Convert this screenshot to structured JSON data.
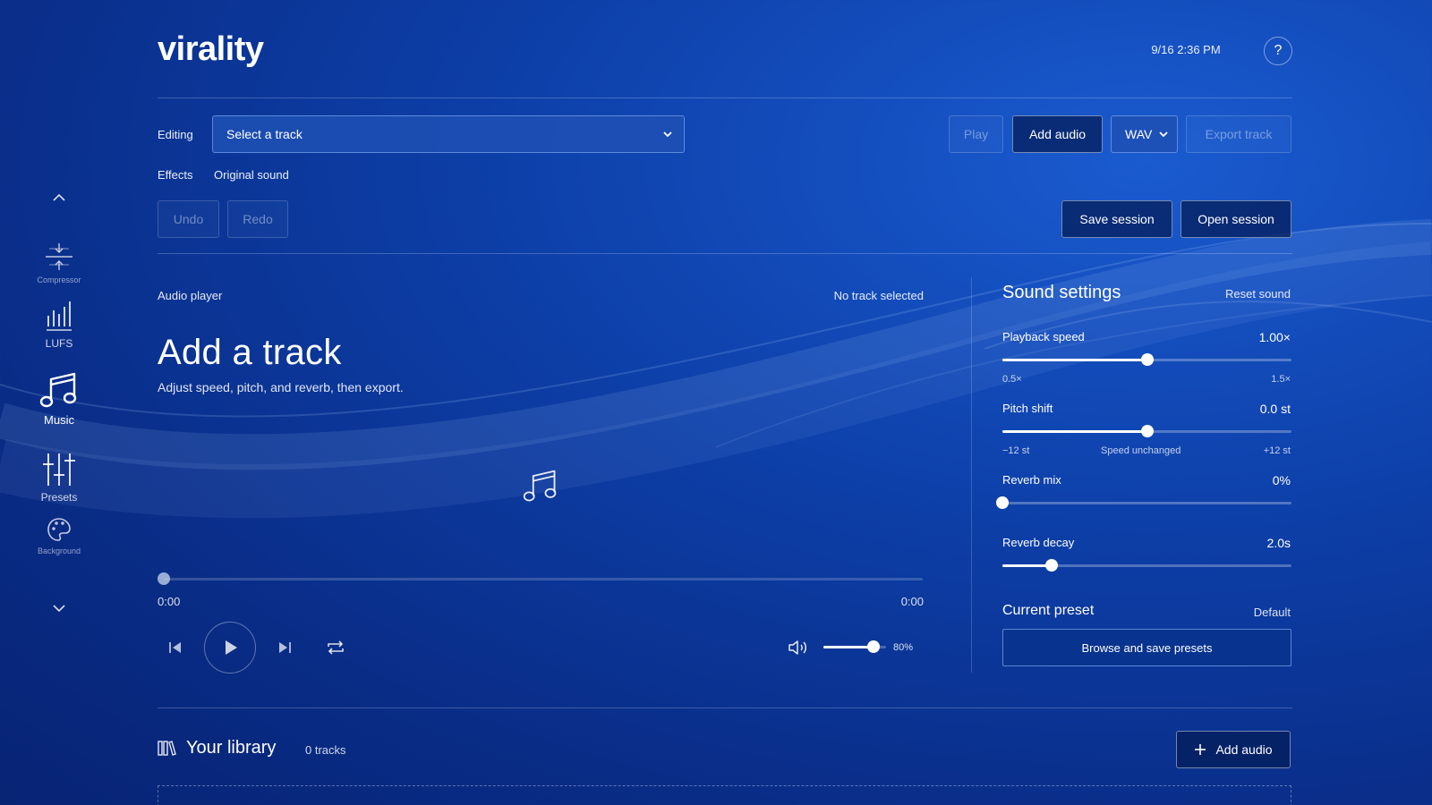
{
  "app": {
    "name": "virality",
    "datetime": "9/16 2:36 PM",
    "help_label": "?"
  },
  "sidebar": {
    "items": [
      {
        "label": "Compressor",
        "icon": "compressor-icon"
      },
      {
        "label": "LUFS",
        "icon": "lufs-icon"
      },
      {
        "label": "Music",
        "icon": "music-note-icon",
        "active": true
      },
      {
        "label": "Presets",
        "icon": "sliders-icon"
      },
      {
        "label": "Background",
        "icon": "palette-icon"
      }
    ]
  },
  "toolbar": {
    "editing_label": "Editing",
    "track_select_value": "Select a track",
    "effects_label": "Effects",
    "effects_value": "Original sound",
    "play_label": "Play",
    "add_audio_label": "Add audio",
    "format_value": "WAV",
    "export_label": "Export track",
    "undo_label": "Undo",
    "redo_label": "Redo",
    "save_session_label": "Save session",
    "open_session_label": "Open session"
  },
  "player": {
    "header": "Audio player",
    "status": "No track selected",
    "title": "Add a track",
    "subtitle": "Adjust speed, pitch, and reverb, then export.",
    "current_time": "0:00",
    "duration": "0:00",
    "progress": 0,
    "volume": 0.8,
    "volume_label": "80%"
  },
  "sound_settings": {
    "title": "Sound settings",
    "reset_label": "Reset sound",
    "playback_speed": {
      "label": "Playback speed",
      "value": "1.00×",
      "level": 0.5,
      "min_label": "0.5×",
      "max_label": "1.5×"
    },
    "pitch_shift": {
      "label": "Pitch shift",
      "value": "0.0 st",
      "level": 0.5,
      "min_label": "−12 st",
      "mid_label": "Speed unchanged",
      "max_label": "+12 st"
    },
    "reverb_mix": {
      "label": "Reverb mix",
      "value": "0%",
      "level": 0
    },
    "reverb_decay": {
      "label": "Reverb decay",
      "value": "2.0s",
      "level": 0.17
    },
    "preset_title": "Current preset",
    "preset_value": "Default",
    "browse_label": "Browse and save presets"
  },
  "library": {
    "title": "Your library",
    "count": "0 tracks",
    "add_label": "Add audio"
  },
  "colors": {
    "background": "#0d3fa8",
    "accent": "#1e50b4"
  }
}
